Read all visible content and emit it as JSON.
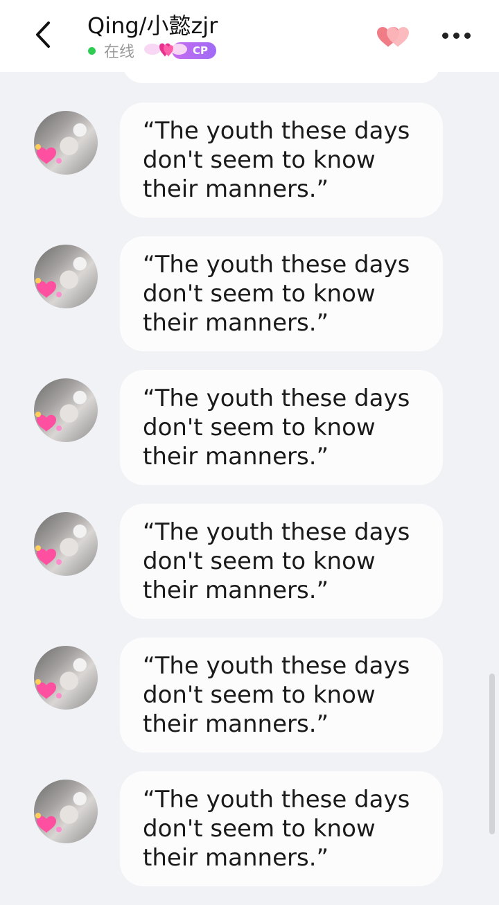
{
  "header": {
    "contact_name": "Qing/小懿zjr",
    "status_text": "在线",
    "status_color": "#2ecc52",
    "cp_badge_label": "CP",
    "back_icon": "chevron-left-icon",
    "hearts_icon": "double-heart-icon",
    "more_icon": "more-dots-icon"
  },
  "messages": [
    {
      "sender": "contact",
      "text": "“The youth these days don't seem to know their manners.”"
    },
    {
      "sender": "contact",
      "text": "“The youth these days don't seem to know their manners.”"
    },
    {
      "sender": "contact",
      "text": "“The youth these days don't seem to know their manners.”"
    },
    {
      "sender": "contact",
      "text": "“The youth these days don't seem to know their manners.”"
    },
    {
      "sender": "contact",
      "text": "“The youth these days don't seem to know their manners.”"
    },
    {
      "sender": "contact",
      "text": "“The youth these days don't seem to know their manners.”"
    }
  ],
  "colors": {
    "background": "#f1f2f6",
    "bubble": "#fcfcfd",
    "accent_pink": "#f3838f",
    "cp_purple": "#b36cf2"
  }
}
